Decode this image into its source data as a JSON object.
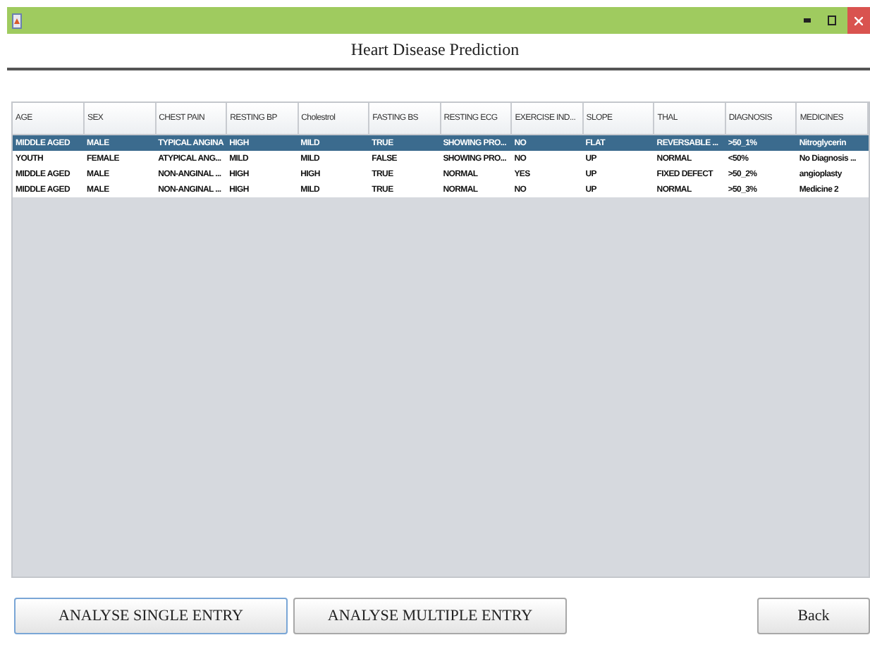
{
  "window": {
    "title": "Heart Disease Prediction"
  },
  "table": {
    "columns": [
      "AGE",
      "SEX",
      "CHEST PAIN",
      "RESTING BP",
      "Cholestrol",
      "FASTING BS",
      "RESTING ECG",
      "EXERCISE IND...",
      "SLOPE",
      "THAL",
      "DIAGNOSIS",
      "MEDICINES"
    ],
    "rows": [
      {
        "selected": true,
        "cells": [
          "MIDDLE AGED",
          "MALE",
          "TYPICAL ANGINA",
          "HIGH",
          "MILD",
          "TRUE",
          "SHOWING PRO...",
          "NO",
          "FLAT",
          "REVERSABLE ...",
          ">50_1%",
          "Nitroglycerin"
        ]
      },
      {
        "selected": false,
        "cells": [
          "YOUTH",
          "FEMALE",
          "ATYPICAL ANG...",
          "MILD",
          "MILD",
          "FALSE",
          "SHOWING PRO...",
          "NO",
          "UP",
          "NORMAL",
          "<50%",
          "No Diagnosis ..."
        ]
      },
      {
        "selected": false,
        "cells": [
          "MIDDLE AGED",
          "MALE",
          "NON-ANGINAL ...",
          "HIGH",
          "HIGH",
          "TRUE",
          "NORMAL",
          "YES",
          "UP",
          "FIXED DEFECT",
          ">50_2%",
          "angioplasty"
        ]
      },
      {
        "selected": false,
        "cells": [
          "MIDDLE AGED",
          "MALE",
          "NON-ANGINAL ...",
          "HIGH",
          "MILD",
          "TRUE",
          "NORMAL",
          "NO",
          "UP",
          "NORMAL",
          ">50_3%",
          "Medicine 2"
        ]
      }
    ]
  },
  "buttons": [
    {
      "label": "ANALYSE SINGLE ENTRY",
      "focused": true
    },
    {
      "label": "ANALYSE MULTIPLE ENTRY",
      "focused": false
    },
    {
      "label": "Back",
      "focused": false
    }
  ]
}
